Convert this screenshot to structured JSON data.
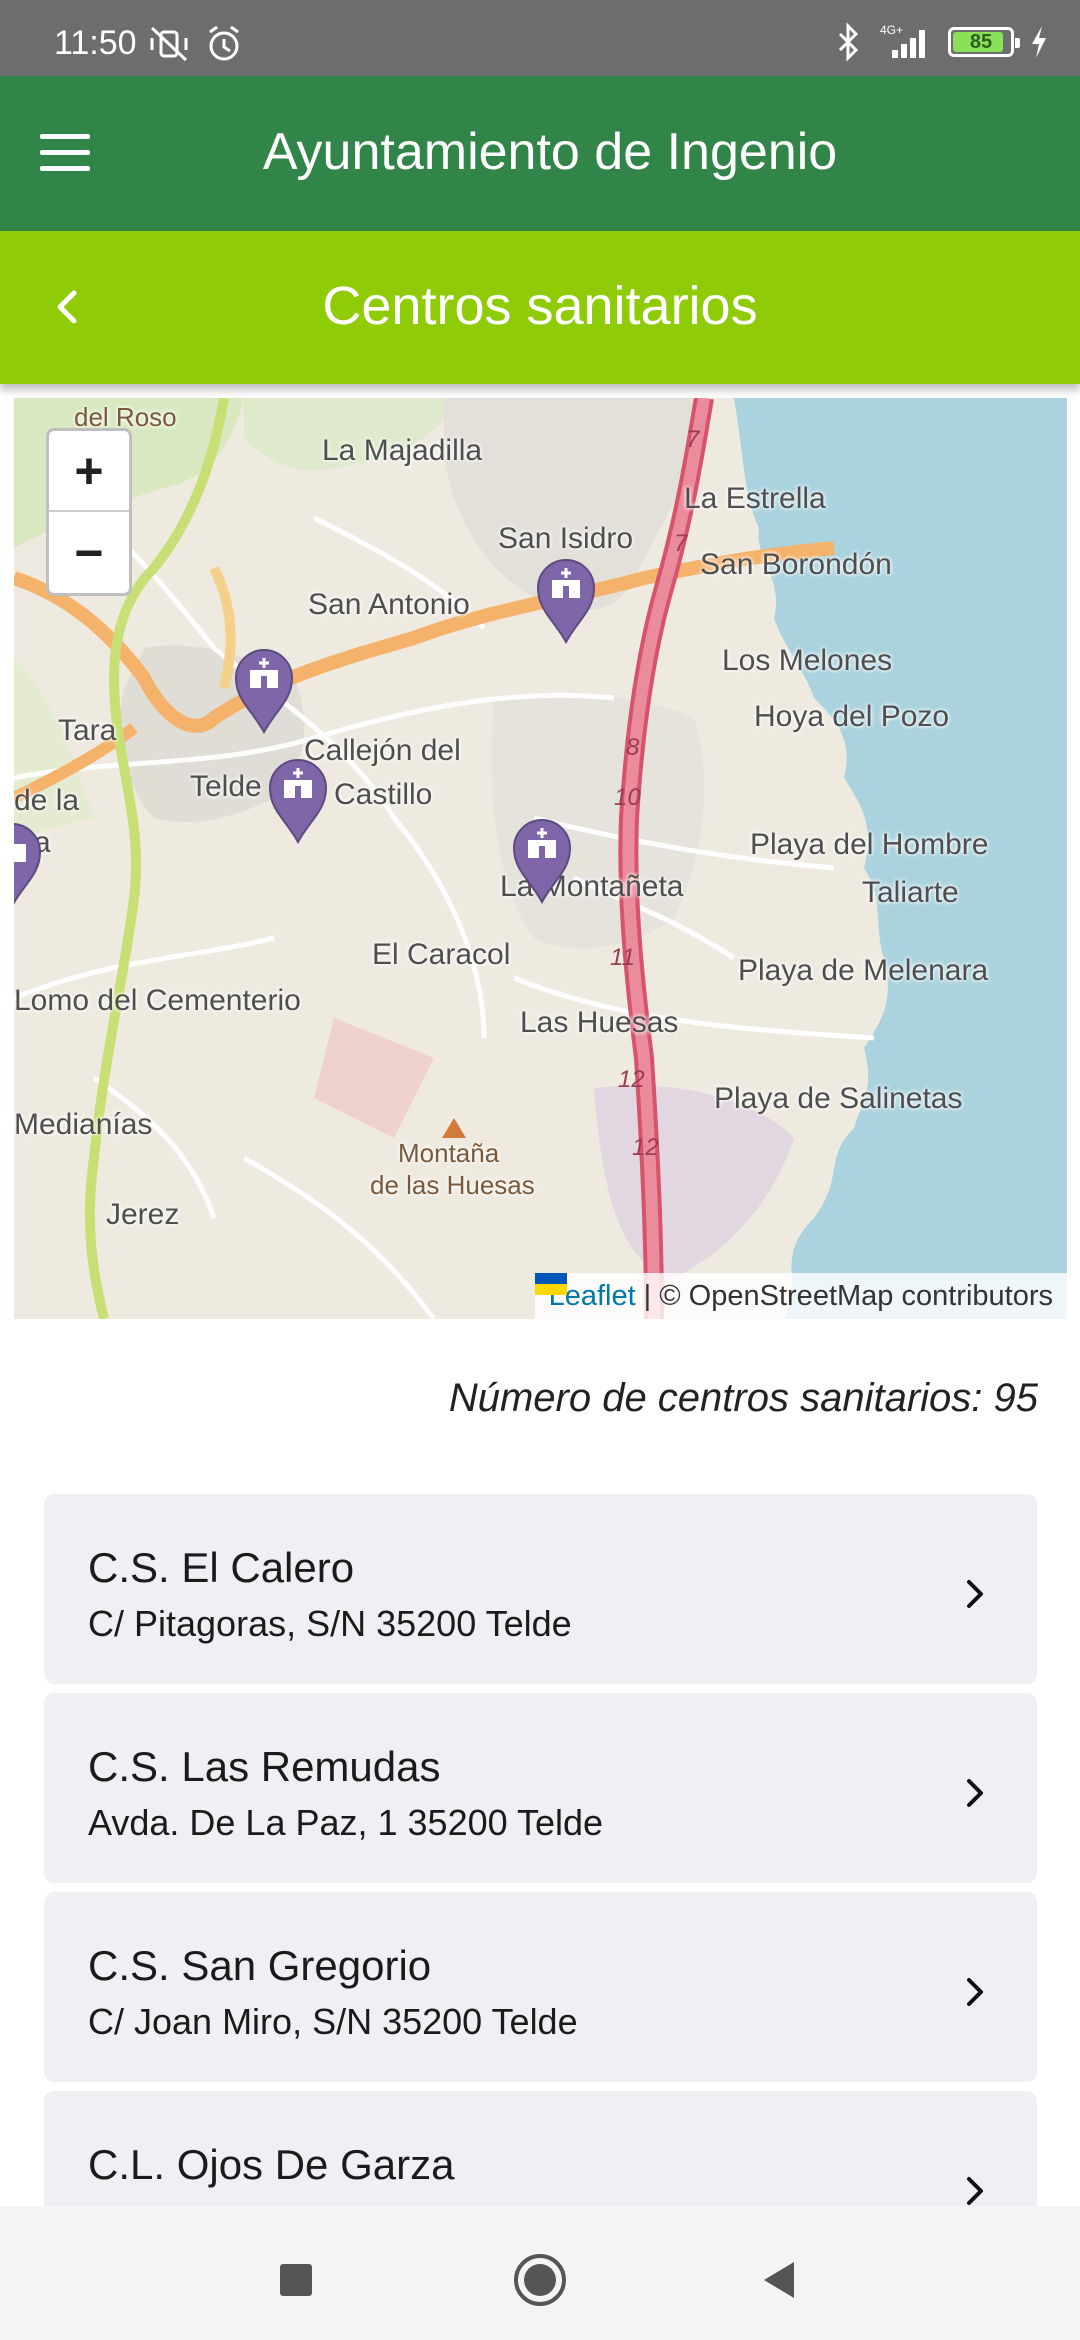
{
  "status_bar": {
    "time": "11:50",
    "network_label": "4G+",
    "battery_level": "85"
  },
  "header": {
    "title": "Ayuntamiento de Ingenio",
    "menu_icon": "hamburger-menu-icon",
    "color": "#318548"
  },
  "sub_header": {
    "title": "Centros sanitarios",
    "back_icon": "chevron-left-icon",
    "color": "#8fcb07"
  },
  "map": {
    "zoom_in": "+",
    "zoom_out": "−",
    "labels": [
      "del Roso",
      "La Majadilla",
      "La Estrella",
      "San Isidro",
      "San Borondón",
      "San Antonio",
      "Los Melones",
      "Hoya del Pozo",
      "Tara",
      "Callejón del",
      "Castillo",
      "Telde",
      "de la",
      "ra",
      "Playa del Hombre",
      "Taliarte",
      "La Montañeta",
      "El Caracol",
      "Playa de Melenara",
      "Lomo del Cementerio",
      "Las Huesas",
      "Playa de Salinetas",
      "Medianías",
      "Montaña",
      "de las Huesas",
      "Jerez"
    ],
    "road_numbers": [
      "7",
      "7",
      "8",
      "10",
      "11",
      "12",
      "12"
    ],
    "marker_count": 5,
    "attribution_link": "Leaflet",
    "attribution_text": "| © OpenStreetMap contributors"
  },
  "count_label": "Número de centros sanitarios: 95",
  "centers": [
    {
      "name": "C.S. El Calero",
      "address": "C/ Pitagoras, S/N 35200 Telde"
    },
    {
      "name": "C.S. Las Remudas",
      "address": "Avda. De La Paz, 1 35200 Telde"
    },
    {
      "name": "C.S. San Gregorio",
      "address": "C/ Joan Miro, S/N 35200 Telde"
    },
    {
      "name": "C.L. Ojos De Garza",
      "address": ""
    }
  ],
  "nav_bar": {
    "recents_icon": "square-recents-icon",
    "home_icon": "circle-home-icon",
    "back_icon": "triangle-back-icon"
  }
}
